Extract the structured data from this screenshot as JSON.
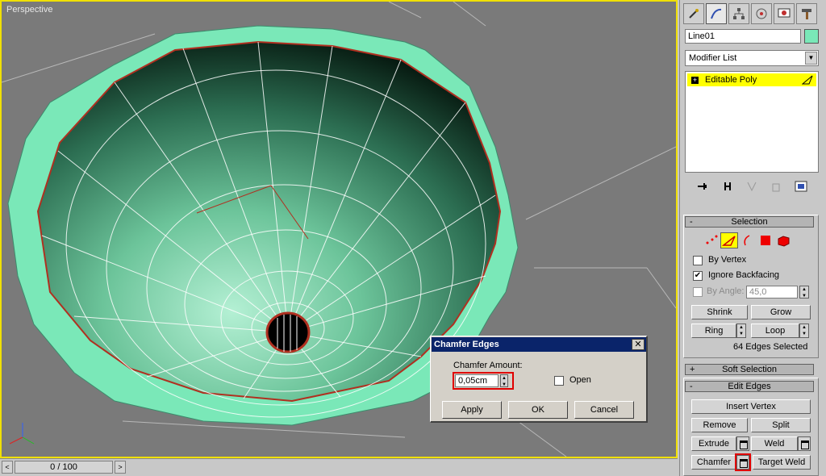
{
  "viewport": {
    "label": "Perspective"
  },
  "timebar": {
    "position": "0 / 100",
    "prev": "<",
    "next": ">"
  },
  "panel": {
    "object_name": "Line01",
    "modifier_list": "Modifier List",
    "stack_item": "Editable Poly",
    "selection": {
      "title": "Selection",
      "by_vertex": "By Vertex",
      "ignore_backfacing": "Ignore Backfacing",
      "ignore_backfacing_checked": true,
      "by_angle": "By Angle:",
      "angle_value": "45,0",
      "shrink": "Shrink",
      "grow": "Grow",
      "ring": "Ring",
      "loop": "Loop",
      "status": "64 Edges Selected"
    },
    "soft_selection": {
      "title": "Soft Selection"
    },
    "edit_edges": {
      "title": "Edit Edges",
      "insert_vertex": "Insert Vertex",
      "remove": "Remove",
      "split": "Split",
      "extrude": "Extrude",
      "weld": "Weld",
      "chamfer": "Chamfer",
      "target_weld": "Target Weld"
    }
  },
  "dialog": {
    "title": "Chamfer Edges",
    "amount_label": "Chamfer Amount:",
    "amount_value": "0,05cm",
    "open_label": "Open",
    "apply": "Apply",
    "ok": "OK",
    "cancel": "Cancel"
  },
  "colors": {
    "accent": "#f0e000",
    "selection": "#ffff00",
    "mesh": "#7ae8b8",
    "title_bar": "#0a246a",
    "highlight": "#e00000"
  }
}
